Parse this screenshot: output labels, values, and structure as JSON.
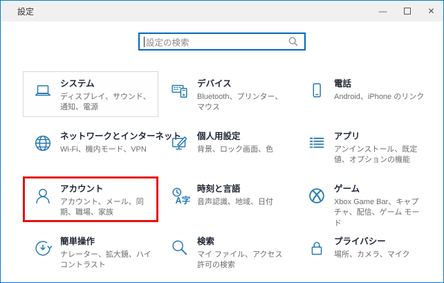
{
  "window": {
    "title": "設定",
    "controls": [
      {
        "name": "minimize",
        "glyph": "—"
      },
      {
        "name": "maximize",
        "glyph": ""
      },
      {
        "name": "close",
        "glyph": "✕"
      }
    ]
  },
  "search": {
    "placeholder": "設定の検索",
    "icon": "search-icon"
  },
  "colors": {
    "accent": "#0078d7",
    "icon_blue": "#2679b2",
    "highlight_red": "#e60f0f",
    "titlebar_bg": "#f0f0f0"
  },
  "tiles": [
    {
      "id": "system",
      "icon": "laptop-icon",
      "title": "システム",
      "subtitle": "ディスプレイ、サウンド、通知、電源",
      "state": "hover"
    },
    {
      "id": "devices",
      "icon": "devices-icon",
      "title": "デバイス",
      "subtitle": "Bluetooth、プリンター、マウス",
      "state": ""
    },
    {
      "id": "phone",
      "icon": "smartphone-icon",
      "title": "電話",
      "subtitle": "Android、iPhone のリンク",
      "state": ""
    },
    {
      "id": "network",
      "icon": "globe-icon",
      "title": "ネットワークとインターネット",
      "subtitle": "Wi-Fi、機内モード、VPN",
      "state": ""
    },
    {
      "id": "personalization",
      "icon": "monitor-brush-icon",
      "title": "個人用設定",
      "subtitle": "背景、ロック画面、色",
      "state": ""
    },
    {
      "id": "apps",
      "icon": "list-icon",
      "title": "アプリ",
      "subtitle": "アンインストール、既定値、オプションの機能",
      "state": ""
    },
    {
      "id": "accounts",
      "icon": "person-icon",
      "title": "アカウント",
      "subtitle": "アカウント、メール、同期、職場、家族",
      "state": "highlighted"
    },
    {
      "id": "time-language",
      "icon": "clock-language-icon",
      "title": "時刻と言語",
      "subtitle": "音声認識、地域、日付",
      "state": ""
    },
    {
      "id": "gaming",
      "icon": "xbox-icon",
      "title": "ゲーム",
      "subtitle": "Xbox Game Bar、キャプチャ、配信、ゲーム モード",
      "state": ""
    },
    {
      "id": "ease-of-access",
      "icon": "ease-of-access-icon",
      "title": "簡単操作",
      "subtitle": "ナレーター、拡大鏡、ハイコントラスト",
      "state": ""
    },
    {
      "id": "search",
      "icon": "magnifier-icon",
      "title": "検索",
      "subtitle": "マイ ファイル、アクセス許可の検索",
      "state": ""
    },
    {
      "id": "privacy",
      "icon": "lock-icon",
      "title": "プライバシー",
      "subtitle": "場所、カメラ、マイク",
      "state": ""
    }
  ]
}
